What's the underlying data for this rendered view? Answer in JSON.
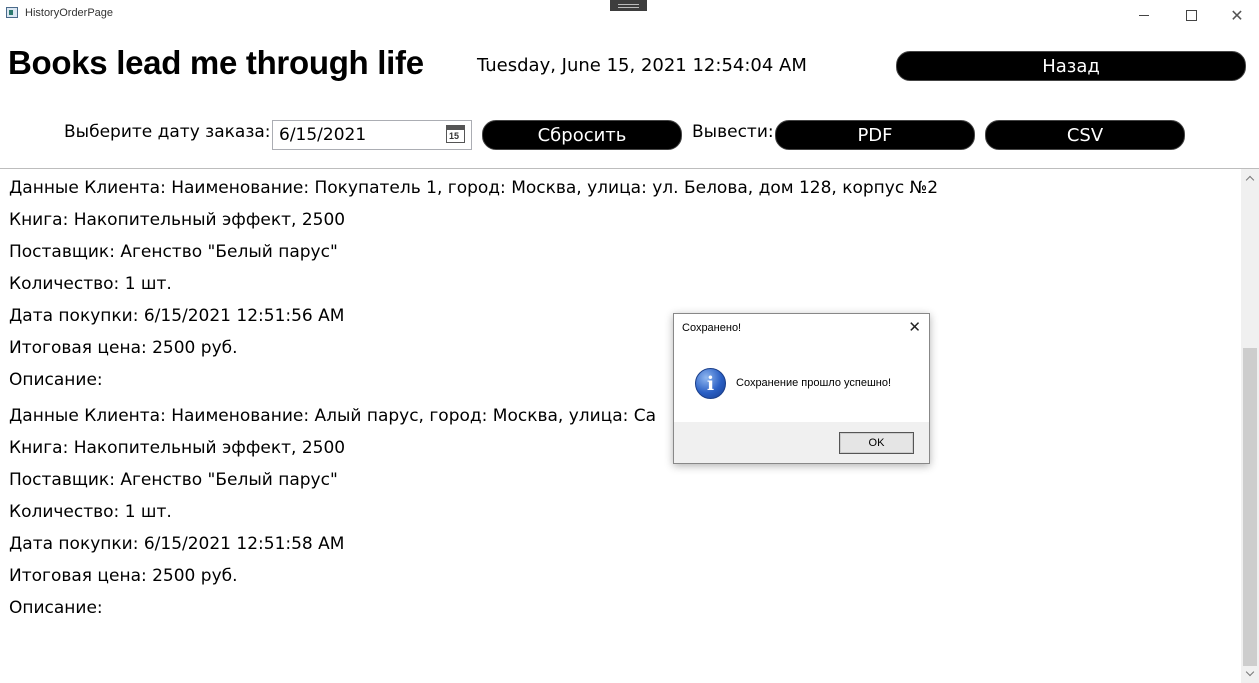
{
  "window": {
    "title": "HistoryOrderPage",
    "controls": {
      "minimize": "minimize-icon",
      "maximize": "maximize-icon",
      "close": "✕"
    }
  },
  "header": {
    "brand": "Books lead me through life",
    "datetime": "Tuesday, June 15, 2021 12:54:04 AM",
    "back_label": "Назад"
  },
  "filters": {
    "date_label": "Выберите дату заказа:",
    "date_value": "6/15/2021",
    "calendar_day": "15",
    "reset_label": "Сбросить",
    "export_label": "Вывести:",
    "pdf_label": "PDF",
    "csv_label": "CSV"
  },
  "orders": [
    {
      "client": "Данные Клиента: Наименование: Покупатель 1, город: Москва, улица: ул. Белова, дом 128, корпус №2",
      "book": "Книга: Накопительный эффект, 2500",
      "supplier": "Поставщик: Агенство \"Белый парус\"",
      "quantity": "Количество: 1 шт.",
      "purchase_date": "Дата покупки: 6/15/2021 12:51:56 AM",
      "total": "Итоговая цена: 2500 руб.",
      "description": "Описание:"
    },
    {
      "client": "Данные Клиента: Наименование: Алый парус, город: Москва, улица: Са",
      "book": "Книга: Накопительный эффект, 2500",
      "supplier": "Поставщик: Агенство \"Белый парус\"",
      "quantity": "Количество: 1 шт.",
      "purchase_date": "Дата покупки: 6/15/2021 12:51:58 AM",
      "total": "Итоговая цена: 2500 руб.",
      "description": "Описание:"
    }
  ],
  "dialog": {
    "title": "Сохранено!",
    "close": "✕",
    "icon": "info-icon",
    "icon_glyph": "i",
    "message": "Сохранение прошло успешно!",
    "ok_label": "OK"
  }
}
